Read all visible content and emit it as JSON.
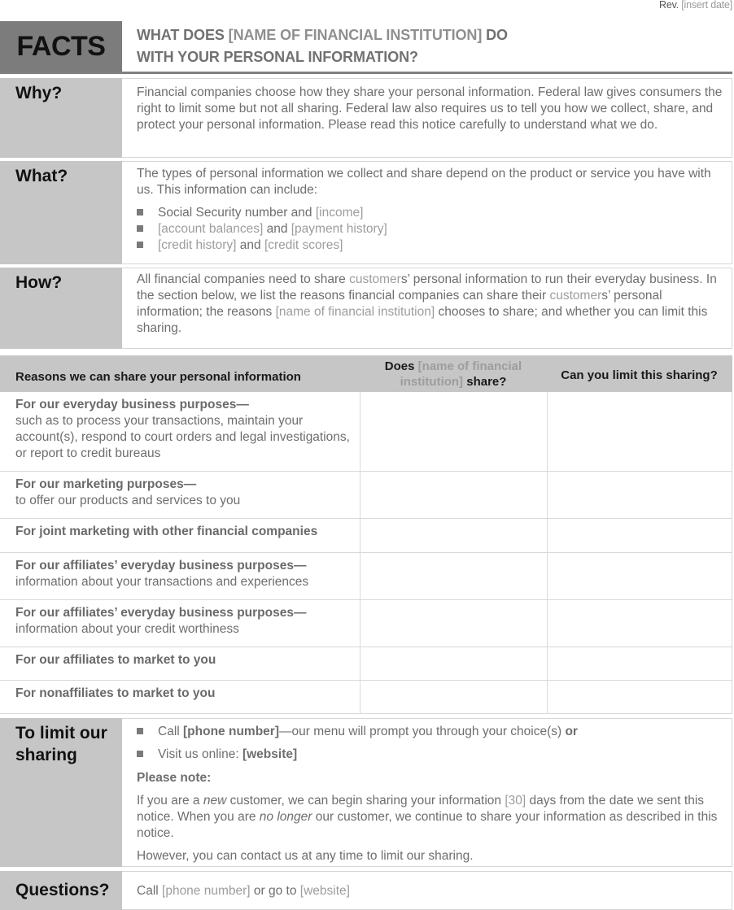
{
  "rev": {
    "prefix": "Rev.",
    "date_placeholder": "[insert date]"
  },
  "header": {
    "facts_label": "FACTS",
    "title_line1_pre": "WHAT DOES ",
    "title_line1_ph": "[NAME OF FINANCIAL INSTITUTION]",
    "title_line1_post": " DO",
    "title_line2": "WITH YOUR PERSONAL INFORMATION?"
  },
  "why": {
    "label": "Why?",
    "text": "Financial companies choose how they share your personal information. Federal law gives consumers the right to limit some but not all sharing. Federal law also requires us to tell you how we collect, share, and protect your personal information. Please read this notice carefully to understand what we do."
  },
  "what": {
    "label": "What?",
    "intro": "The types of personal information we collect and share depend on the product or service you have with us. This information can include:",
    "bullets": [
      {
        "a": "Social Security number",
        "join": " and ",
        "b": "[income]",
        "a_ph": false
      },
      {
        "a": "[account balances]",
        "join": " and ",
        "b": "[payment history]",
        "a_ph": true
      },
      {
        "a": "[credit history]",
        "join": " and ",
        "b": "[credit scores]",
        "a_ph": true
      }
    ]
  },
  "how": {
    "label": "How?",
    "s1": "All financial companies need to share ",
    "ph1": "customer",
    "s2": "s’ personal information to run their everyday business. In the section below, we list the reasons financial companies can share their ",
    "ph2": "customer",
    "s3": "s’ personal information; the reasons ",
    "ph3": "[name of financial institution]",
    "s4": " chooses to share; and whether you can limit this sharing."
  },
  "table": {
    "col1": "Reasons we can share your personal information",
    "col2_pre": "Does ",
    "col2_ph": "[name of financial institution]",
    "col2_post": " share?",
    "col3": "Can you limit this sharing?",
    "rows": [
      {
        "heading": "For our everyday business purposes—",
        "detail": "such as to process your transactions, maintain your account(s), respond to court orders and legal investigations, or report to credit bureaus",
        "shares": "",
        "can_limit": ""
      },
      {
        "heading": "For our marketing purposes—",
        "detail": "to offer our products and services to you",
        "shares": "",
        "can_limit": ""
      },
      {
        "heading": "For joint marketing with other financial companies",
        "detail": "",
        "shares": "",
        "can_limit": ""
      },
      {
        "heading": "For our affiliates’ everyday business purposes—",
        "detail": "information about your transactions and experiences",
        "shares": "",
        "can_limit": ""
      },
      {
        "heading": "For our affiliates’ everyday business purposes—",
        "detail": "information about your credit worthiness",
        "shares": "",
        "can_limit": ""
      },
      {
        "heading": "For our affiliates to market to you",
        "detail": "",
        "shares": "",
        "can_limit": ""
      },
      {
        "heading": "For nonaffiliates to market to you",
        "detail": "",
        "shares": "",
        "can_limit": ""
      }
    ]
  },
  "limit": {
    "label": "To limit our sharing",
    "b1_pre": "Call ",
    "b1_bold": "[phone number]",
    "b1_post": "—our menu will prompt you through your choice(s) ",
    "b1_or": "or",
    "b2_pre": "Visit us online: ",
    "b2_bold": "[website]",
    "note_heading": "Please note:",
    "note_s1": "If you are a ",
    "note_new": "new",
    "note_s2": " customer, we can begin sharing your information ",
    "note_days": "[30]",
    "note_s3": " days from the date we sent this notice. When you are ",
    "note_nolonger": "no longer",
    "note_s4": " our customer, we continue to share your information as described in this notice.",
    "however": "However, you can contact us at any time to limit our sharing."
  },
  "questions": {
    "label": "Questions?",
    "s1": "Call ",
    "phone": "[phone number]",
    "s2": " or go to ",
    "website": "[website]"
  }
}
